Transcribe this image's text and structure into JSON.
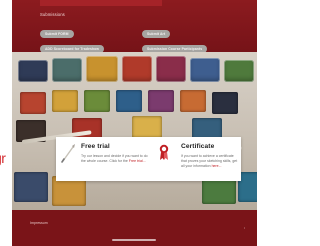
{
  "header": {
    "title": "Submissions"
  },
  "buttons": [
    {
      "label": "Submit FORM"
    },
    {
      "label": "Submit Art"
    },
    {
      "label": "ADD Scoreboard for Tradeshow"
    },
    {
      "label": "Submission Course Participants"
    }
  ],
  "background_fragment": {
    "text": "gr"
  },
  "card": {
    "trial": {
      "title": "Free trial",
      "text": "Try our lesson and decide if you want to do the whole course. Click for the",
      "link": "Free trial..."
    },
    "certificate": {
      "title": "Certificate",
      "text": "If you want to achieve a certificate that proves your sketching skills, get all your information",
      "link": "here..."
    }
  },
  "footer": {
    "text": "Impressum",
    "badge": "↕"
  },
  "colors": {
    "brand_red": "#7b1418",
    "button_gray": "#a7a5a2",
    "link_red": "#c02025"
  },
  "icons": {
    "trial": "brush-icon",
    "certificate": "ribbon-award-icon"
  }
}
